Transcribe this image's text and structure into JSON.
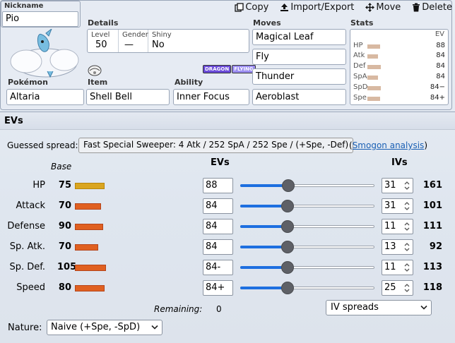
{
  "set": {
    "nickname_label": "Nickname",
    "nickname_value": "Pio",
    "details_label": "Details",
    "details": {
      "level_label": "Level",
      "level_value": "50",
      "gender_label": "Gender",
      "gender_value": "—",
      "shiny_label": "Shiny",
      "shiny_value": "No"
    },
    "types": [
      "DRAGON",
      "FLYING"
    ],
    "pokemon_label": "Pokémon",
    "pokemon_value": "Altaria",
    "item_label": "Item",
    "item_value": "Shell Bell",
    "ability_label": "Ability",
    "ability_value": "Inner Focus",
    "moves_label": "Moves",
    "moves": [
      "Magical Leaf",
      "Fly",
      "Thunder",
      "Aeroblast"
    ],
    "stats_label": "Stats",
    "stats_ev_header": "EV",
    "stats_summary": [
      {
        "name": "HP",
        "ev": "88",
        "fraction": 0.35
      },
      {
        "name": "Atk",
        "ev": "84",
        "fraction": 0.3
      },
      {
        "name": "Def",
        "ev": "84",
        "fraction": 0.37
      },
      {
        "name": "SpA",
        "ev": "84",
        "fraction": 0.3
      },
      {
        "name": "SpD",
        "ev": "84−",
        "fraction": 0.37
      },
      {
        "name": "Spe",
        "ev": "84+",
        "fraction": 0.35
      }
    ]
  },
  "toolbar": {
    "copy": "Copy",
    "copy_icon": "clipboard-icon",
    "import_export": "Import/Export",
    "import_icon": "upload-icon",
    "move": "Move",
    "move_icon": "move-arrows-icon",
    "delete": "Delete",
    "delete_icon": "trash-icon"
  },
  "evs": {
    "title": "EVs",
    "guessed_label": "Guessed spread:",
    "guessed_value": "Fast Special Sweeper: 4 Atk / 252 SpA / 252 Spe / (+Spe, -Def)",
    "smogon_open": "(",
    "smogon_link": "Smogon analysis",
    "smogon_close": ")",
    "base_header": "Base",
    "evs_header": "EVs",
    "ivs_header": "IVs",
    "rows": [
      {
        "name": "HP",
        "base": "75",
        "base_fraction": 0.58,
        "base_color": "#daa520",
        "ev": "88",
        "ev_fraction": 0.36,
        "iv": "31",
        "total": "161"
      },
      {
        "name": "Attack",
        "base": "70",
        "base_fraction": 0.51,
        "base_color": "#e06020",
        "ev": "84",
        "ev_fraction": 0.35,
        "iv": "31",
        "total": "101"
      },
      {
        "name": "Defense",
        "base": "90",
        "base_fraction": 0.56,
        "base_color": "#e06020",
        "ev": "84",
        "ev_fraction": 0.35,
        "iv": "11",
        "total": "111"
      },
      {
        "name": "Sp. Atk.",
        "base": "70",
        "base_fraction": 0.46,
        "base_color": "#e06020",
        "ev": "84",
        "ev_fraction": 0.35,
        "iv": "13",
        "total": "92"
      },
      {
        "name": "Sp. Def.",
        "base": "105",
        "base_fraction": 0.61,
        "base_color": "#e06020",
        "ev": "84-",
        "ev_fraction": 0.35,
        "iv": "11",
        "total": "113"
      },
      {
        "name": "Speed",
        "base": "80",
        "base_fraction": 0.58,
        "base_color": "#e06020",
        "ev": "84+",
        "ev_fraction": 0.35,
        "iv": "25",
        "total": "118"
      }
    ],
    "remaining_label": "Remaining:",
    "remaining_value": "0",
    "ivspreads_value": "IV spreads",
    "nature_label": "Nature:",
    "nature_value": "Naive (+Spe, -SpD)"
  }
}
